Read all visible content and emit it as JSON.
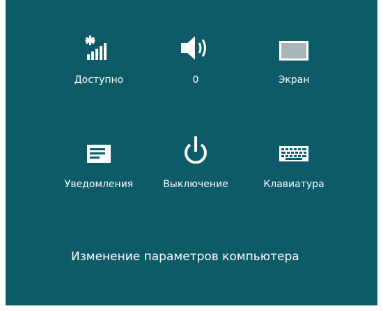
{
  "quick_settings": {
    "network": {
      "label": "Доступно",
      "icon": "network-signal-icon"
    },
    "volume": {
      "label": "0",
      "icon": "speaker-icon"
    },
    "screen": {
      "label": "Экран",
      "icon": "screen-brightness-icon"
    },
    "notifications": {
      "label": "Уведомления",
      "icon": "notifications-icon"
    },
    "power": {
      "label": "Выключение",
      "icon": "power-icon"
    },
    "keyboard": {
      "label": "Клавиатура",
      "icon": "keyboard-icon"
    }
  },
  "change_settings_link": "Изменение параметров компьютера",
  "colors": {
    "background": "#0d5a69",
    "foreground": "#ffffff"
  }
}
